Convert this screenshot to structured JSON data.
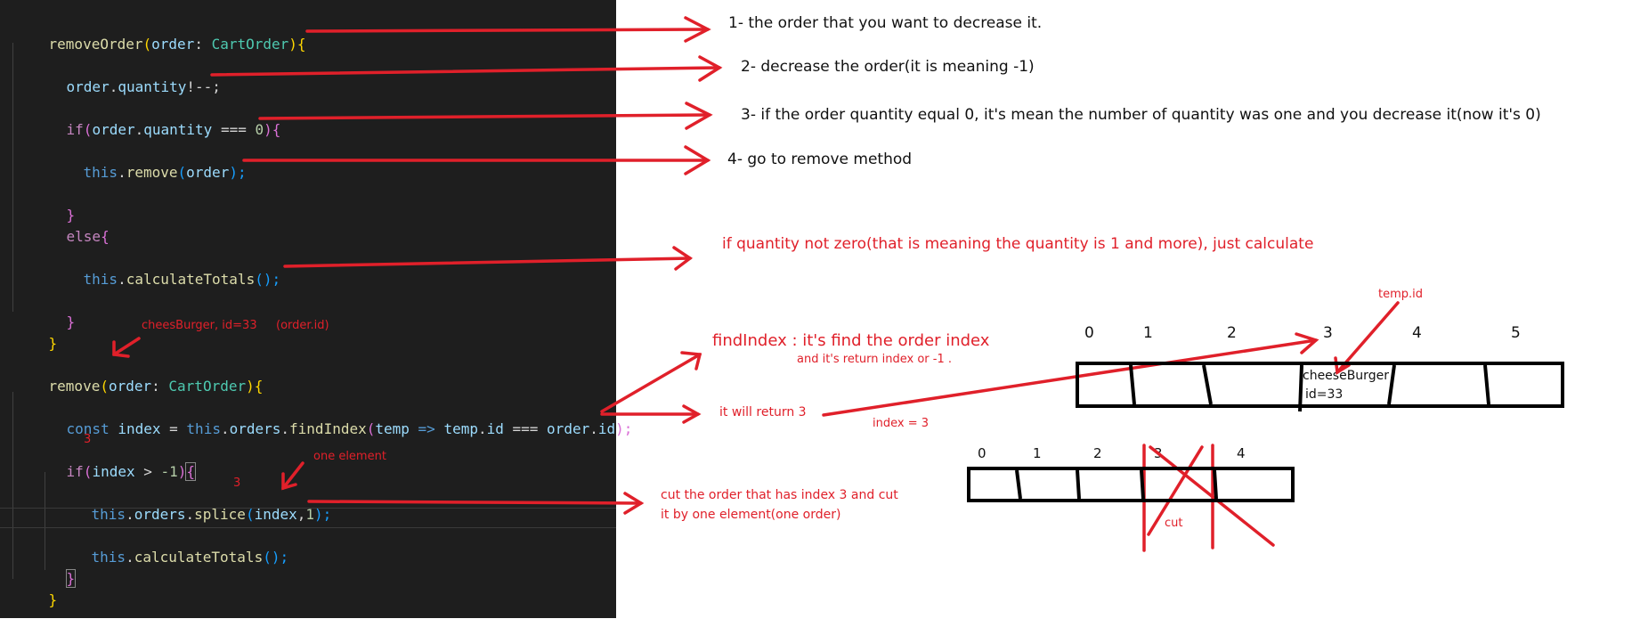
{
  "code": {
    "line1": {
      "fn": "removeOrder",
      "p1": "(",
      "arg": "order",
      "colon": ": ",
      "type": "CartOrder",
      "p2": ")",
      "brace": "{"
    },
    "line2": {
      "obj": "order",
      "dot": ".",
      "prop": "quantity",
      "rest": "!--;"
    },
    "line3": {
      "kw": "if",
      "p1": "(",
      "obj": "order",
      "dot": ".",
      "prop": "quantity",
      "op": " === ",
      "num": "0",
      "p2": ")",
      "brace": "{"
    },
    "line4": {
      "this": "this",
      "dot": ".",
      "fn": "remove",
      "p1": "(",
      "arg": "order",
      "p2": ");"
    },
    "line5": {
      "brace": "}"
    },
    "line6": {
      "kw": "else",
      "brace": "{"
    },
    "line7": {
      "this": "this",
      "dot": ".",
      "fn": "calculateTotals",
      "rest": "();"
    },
    "line8": {
      "brace": "}"
    },
    "line9": {
      "brace": "}"
    },
    "line10": {
      "fn": "remove",
      "p1": "(",
      "arg": "order",
      "colon": ": ",
      "type": "CartOrder",
      "p2": ")",
      "brace": "{"
    },
    "line11": {
      "kw": "const",
      "sp": " ",
      "var": "index",
      "eq": " = ",
      "this": "this",
      "dot": ".",
      "obj": "orders",
      "dot2": ".",
      "fn": "findIndex",
      "p1": "(",
      "arg": "temp",
      "arrow": " => ",
      "obj2": "temp",
      "dot3": ".",
      "prop": "id",
      "op": " === ",
      "obj3": "order",
      "dot4": ".",
      "prop2": "id",
      "p2": ");"
    },
    "line12": {
      "kw": "if",
      "p1": "(",
      "var": "index",
      "op": " > ",
      "num": "-1",
      "p2": ")",
      "brace": "{"
    },
    "line13": {
      "this": "this",
      "dot": ".",
      "obj": "orders",
      "dot2": ".",
      "fn": "splice",
      "p1": "(",
      "var": "index",
      "comma": ",",
      "num": "1",
      "p2": ");"
    },
    "line14": {
      "this": "this",
      "dot": ".",
      "fn": "calculateTotals",
      "rest": "();"
    },
    "line15": {
      "brace": "}"
    },
    "line16": {
      "brace": "}"
    }
  },
  "notes": {
    "n1": "1- the order that you want to decrease it.",
    "n2": "2- decrease the order(it is meaning -1)",
    "n3": "3- if the order quantity equal 0, it's mean the number of quantity was one and you decrease it(now it's 0)",
    "n4": "4- go to remove method",
    "n5": "if quantity not zero(that is meaning the quantity is 1 and more), just calculate",
    "cheese_id": "cheesBurger, id=33",
    "order_id": "(order.id)",
    "find_index_title": "findIndex : it's find the order index",
    "find_index_sub": "and it's return index or -1 .",
    "it_will_return": "it will return 3",
    "index_eq": "index = 3",
    "one_element": "one element",
    "three_a": "3",
    "three_b": "3",
    "cut_line1": "cut the order that has index 3 and cut",
    "cut_line2": "it by one element(one order)",
    "temp_id": "temp.id",
    "cell_name": "cheeseBurger",
    "cell_id": "id=33",
    "cut": "cut"
  },
  "array_top": {
    "indices": [
      "0",
      "1",
      "2",
      "3",
      "4",
      "5"
    ]
  },
  "array_bottom": {
    "indices": [
      "0",
      "1",
      "2",
      "3",
      "4"
    ]
  },
  "colors": {
    "editor_bg": "#1e1e1e",
    "annotation_red": "#e0202a"
  }
}
